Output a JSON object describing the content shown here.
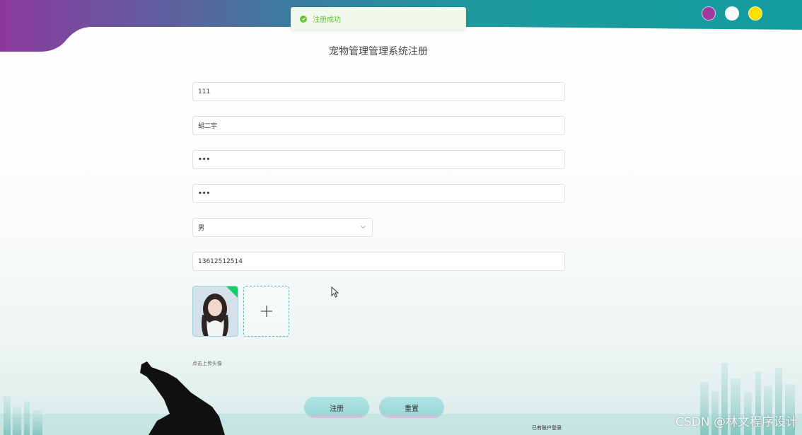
{
  "toast": {
    "message": "注册成功",
    "icon": "success-check-icon",
    "color": "#67c23a"
  },
  "window_dots": [
    "#a03a9e",
    "#ffffff",
    "#ffe100"
  ],
  "title": "宠物管理管理系统注册",
  "form": {
    "account": "111",
    "name": "胡二宇",
    "password": "•••",
    "confirm_password": "•••",
    "gender": "男",
    "phone": "13612512514",
    "upload_hint": "点击上传头像"
  },
  "buttons": {
    "register": "注册",
    "reset": "重置"
  },
  "login_link": "已有账户登录",
  "watermark": "CSDN @林文程序设计",
  "colors": {
    "accent": "#1a9e9e",
    "banner_purple": "#8b3a9c",
    "success": "#67c23a"
  }
}
